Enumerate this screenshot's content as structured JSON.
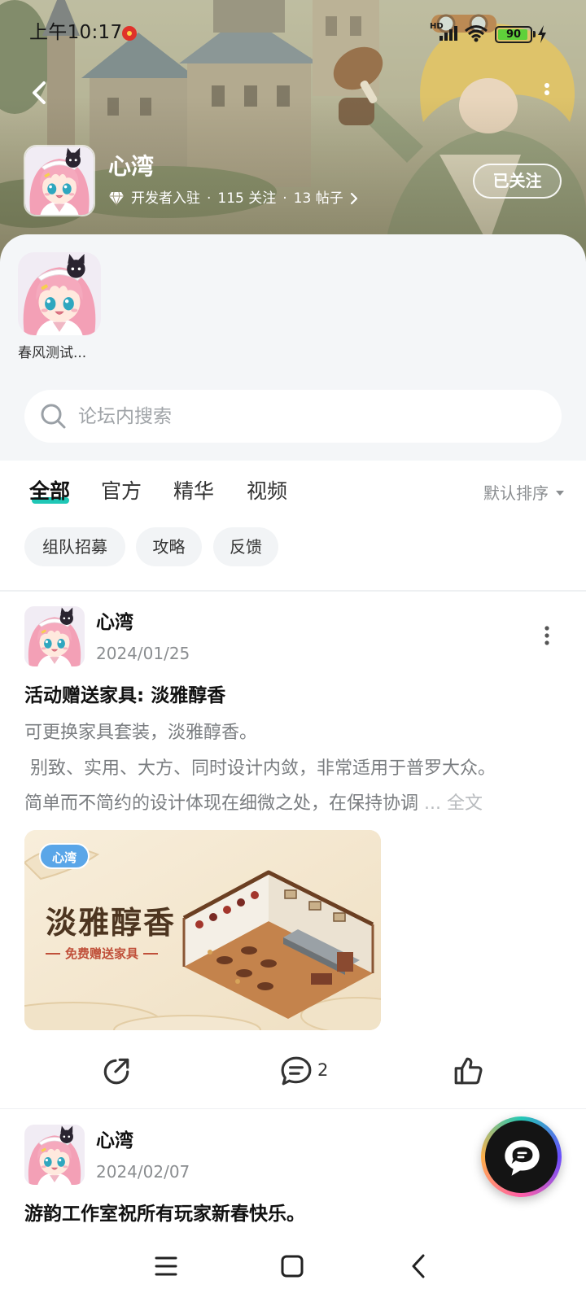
{
  "status_bar": {
    "time": "上午10:17",
    "network_label": "HD",
    "battery_level": "90"
  },
  "header": {
    "title": "心湾",
    "badge": "开发者入驻",
    "separator": "·",
    "follows": "115 关注",
    "posts": "13 帖子",
    "follow_button": "已关注"
  },
  "games": [
    {
      "label": "春风测试..."
    }
  ],
  "search": {
    "placeholder": "论坛内搜索"
  },
  "tabs": [
    {
      "label": "全部",
      "active": true
    },
    {
      "label": "官方",
      "active": false
    },
    {
      "label": "精华",
      "active": false
    },
    {
      "label": "视频",
      "active": false
    }
  ],
  "sort": {
    "label": "默认排序"
  },
  "chips": [
    "组队招募",
    "攻略",
    "反馈"
  ],
  "posts": [
    {
      "author": "心湾",
      "date": "2024/01/25",
      "title": "活动赠送家具: 淡雅醇香",
      "body_lines": [
        "可更换家具套装，淡雅醇香。",
        " 别致、实用、大方、同时设计内敛，非常适用于普罗大众。",
        "简单而不简约的设计体现在细微之处，在保持协调"
      ],
      "truncation": " ... ",
      "read_more": "全文",
      "image": {
        "logo": "心湾",
        "title": "淡雅醇香",
        "subtitle": "免费赠送家具"
      },
      "comment_count": "2"
    },
    {
      "author": "心湾",
      "date": "2024/02/07",
      "title": "游韵工作室祝所有玩家新春快乐。"
    }
  ],
  "colors": {
    "accent": "#1fc7b6",
    "sheet_background": "#f4f6f8",
    "chip_background": "#f2f4f6",
    "text_primary": "#111111",
    "text_muted": "#8a8d90",
    "battery_fill": "#5fd13a",
    "fab_background": "#141414"
  },
  "icons": [
    "back-arrow-icon",
    "more-icon",
    "diamond-icon",
    "chevron-right-icon",
    "search-icon",
    "post-more-icon",
    "share-icon",
    "comment-icon",
    "like-icon",
    "chat-bot-icon",
    "menu-icon",
    "home-icon",
    "nav-back-icon",
    "signal-icon",
    "wifi-icon",
    "battery-icon",
    "charging-icon"
  ]
}
